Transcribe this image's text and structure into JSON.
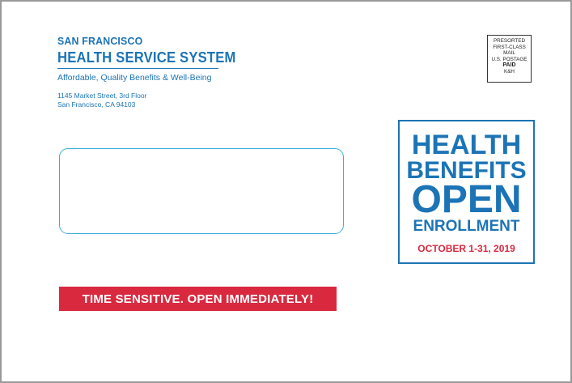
{
  "sender": {
    "org_line1": "SAN FRANCISCO",
    "org_line2": "HEALTH SERVICE SYSTEM",
    "tagline": "Affordable, Quality Benefits & Well-Being",
    "address_line1": "1145 Market Street, 3rd Floor",
    "address_line2": "San Francisco, CA 94103"
  },
  "postage": {
    "line1": "PRESORTED",
    "line2": "FIRST-CLASS MAIL",
    "line3": "U.S. POSTAGE",
    "line4": "PAID",
    "line5": "K&H"
  },
  "banner": {
    "text": "TIME SENSITIVE. OPEN IMMEDIATELY!"
  },
  "promo": {
    "line1": "HEALTH",
    "line2": "BENEFITS",
    "line3": "OPEN",
    "line4": "ENROLLMENT",
    "dates": "OCTOBER 1-31, 2019"
  },
  "colors": {
    "brand_blue": "#1c74b6",
    "alert_red": "#d8293f",
    "window_cyan": "#3ab0de"
  }
}
